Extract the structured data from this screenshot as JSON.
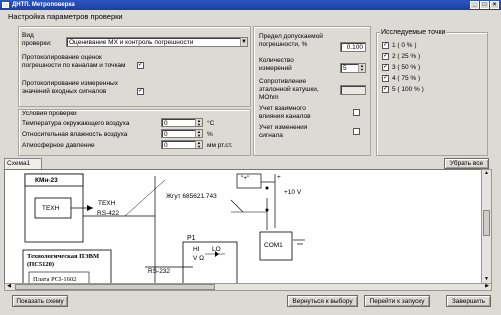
{
  "window": {
    "title": "ДНТП. Метроповерка"
  },
  "heading": "Настройка параметров проверки",
  "left": {
    "type_label": "Вид проверки:",
    "type_value": "Оценивание МХ и контроль погрешности",
    "log_channels_label": "Протоколирование оценок погрешности по каналам и точкам",
    "log_inputs_label": "Протоколирование измеренных значений входных сигналов",
    "conditions_title": "Условия проверки",
    "temp_label": "Температура окружающего воздуха",
    "temp_value": "0",
    "temp_unit": "°С",
    "humidity_label": "Относительная влажность воздуха",
    "humidity_value": "0",
    "humidity_unit": "%",
    "pressure_label": "Атмосферное давление",
    "pressure_value": "0",
    "pressure_unit": "мм рт.ст."
  },
  "middle": {
    "error_label": "Предел допускаемой погрешности, %",
    "error_value": "0.100",
    "count_label": "Количество измерений",
    "count_value": "5",
    "resistance_label": "Сопротивление эталонной катушки, МОhm",
    "resistance_value": "",
    "influence_label": "Учет взаимного влияния каналов",
    "change_label": "Учет изменения сигнала"
  },
  "points": {
    "title": "Исследуемые точки",
    "items": [
      {
        "label": "1 ( 0 % )",
        "checked": "✓"
      },
      {
        "label": "2 ( 25 % )",
        "checked": "✓"
      },
      {
        "label": "3 ( 50 % )",
        "checked": "✓"
      },
      {
        "label": "4 ( 75 % )",
        "checked": "✓"
      },
      {
        "label": "5 ( 100 % )",
        "checked": "✓"
      }
    ]
  },
  "scheme": {
    "tab": "Схема1",
    "remove_all": "Убрать все",
    "kmn": "КМн-23",
    "tekh": "ТЕХН",
    "tekh2": "ТЕХН",
    "rs422": "RS-422",
    "cable": "Жгут 685621.743",
    "p1": "P1",
    "tech_pc": "Технологическая ПЭВМ",
    "tech_pc2": "(ПС5120)",
    "board": "Плата PCI-1602",
    "rs232": "RS-232",
    "hi": "HI",
    "lo": "LO",
    "v": "V Ω",
    "com": "COM1",
    "plus10": "+10 V",
    "plus": "+",
    "plusv": "\"+\""
  },
  "footer": {
    "show_scheme": "Показать схему",
    "back": "Вернуться к выбору",
    "run": "Перейти к запуску",
    "finish": "Завершить"
  }
}
